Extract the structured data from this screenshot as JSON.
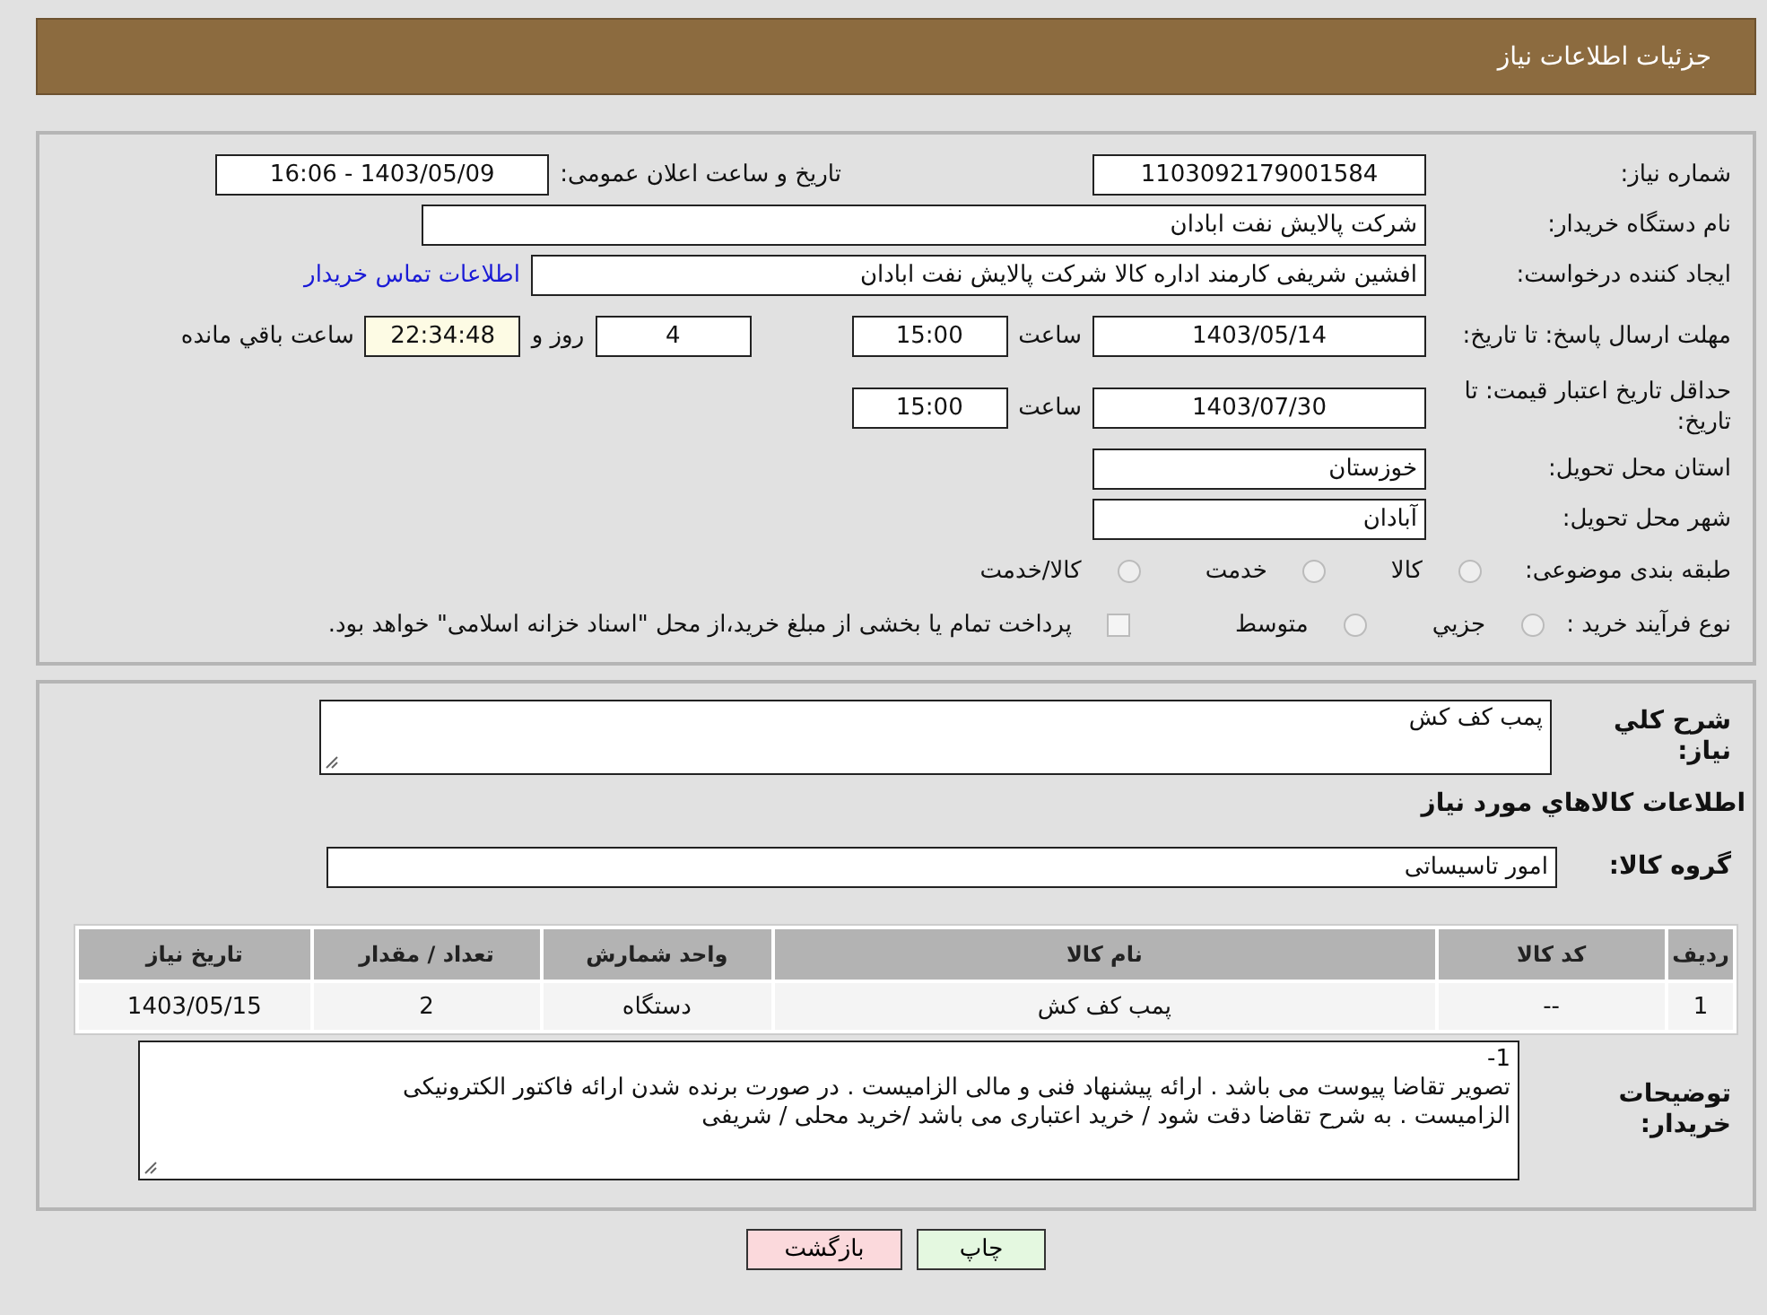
{
  "header": {
    "title": "جزئیات اطلاعات نیاز"
  },
  "details": {
    "need_number": {
      "label": "شماره نیاز:",
      "value": "1103092179001584"
    },
    "announce": {
      "label": "تاریخ و ساعت اعلان عمومی:",
      "value": "1403/05/09 - 16:06"
    },
    "buyer_org": {
      "label": "نام دستگاه خریدار:",
      "value": "شرکت پالایش نفت ابادان"
    },
    "creator": {
      "label": "ایجاد کننده درخواست:",
      "value": "افشین شریفی کارمند اداره کالا  شرکت پالایش نفت ابادان",
      "link": "اطلاعات تماس خریدار"
    },
    "reply_deadline": {
      "label": "مهلت ارسال پاسخ: تا تاریخ:",
      "date": "1403/05/14",
      "time_label": "ساعت",
      "time": "15:00",
      "days": "4",
      "days_label": "روز و",
      "remaining": "22:34:48",
      "remaining_label": "ساعت باقي مانده"
    },
    "price_validity": {
      "label": "حداقل تاریخ اعتبار قیمت: تا تاریخ:",
      "date": "1403/07/30",
      "time_label": "ساعت",
      "time": "15:00"
    },
    "province": {
      "label": "استان محل تحویل:",
      "value": "خوزستان"
    },
    "city": {
      "label": "شهر محل تحویل:",
      "value": "آبادان"
    },
    "category": {
      "label": "طبقه بندی موضوعی:",
      "options": [
        {
          "label": "کالا",
          "selected": false
        },
        {
          "label": "خدمت",
          "selected": false
        },
        {
          "label": "کالا/خدمت",
          "selected": false
        }
      ]
    },
    "process": {
      "label": "نوع فرآیند خرید :",
      "options": [
        {
          "label": "جزيي",
          "selected": false
        },
        {
          "label": "متوسط",
          "selected": false
        }
      ],
      "treasury": {
        "label": "پرداخت تمام یا بخشی از مبلغ خرید،از محل \"اسناد خزانه اسلامی\" خواهد بود.",
        "checked": false
      }
    }
  },
  "goods": {
    "summary": {
      "label": "شرح کلي نیاز:",
      "value": "پمب کف کش"
    },
    "heading": "اطلاعات کالاهاي مورد نیاز",
    "group": {
      "label": "گروه کالا:",
      "value": "امور تاسیساتی"
    },
    "table": {
      "columns": [
        "ردیف",
        "کد کالا",
        "نام کالا",
        "واحد شمارش",
        "تعداد / مقدار",
        "تاریخ نیاز"
      ],
      "rows": [
        [
          "1",
          "--",
          "پمب کف کش",
          "دستگاه",
          "2",
          "1403/05/15"
        ]
      ]
    },
    "notes": {
      "label": "توضیحات خریدار:",
      "lines": [
        "1-",
        "تصویر تقاضا پیوست می باشد . ارائه پیشنهاد فنی و مالی الزامیست . در صورت برنده شدن ارائه فاکتور الکترونیکی",
        "الزامیست . به شرح تقاضا دقت شود  / خرید اعتباری می باشد /خرید محلی / شریفی"
      ]
    }
  },
  "buttons": [
    {
      "label": "چاپ",
      "kind": "print"
    },
    {
      "label": "بازگشت",
      "kind": "back"
    }
  ]
}
